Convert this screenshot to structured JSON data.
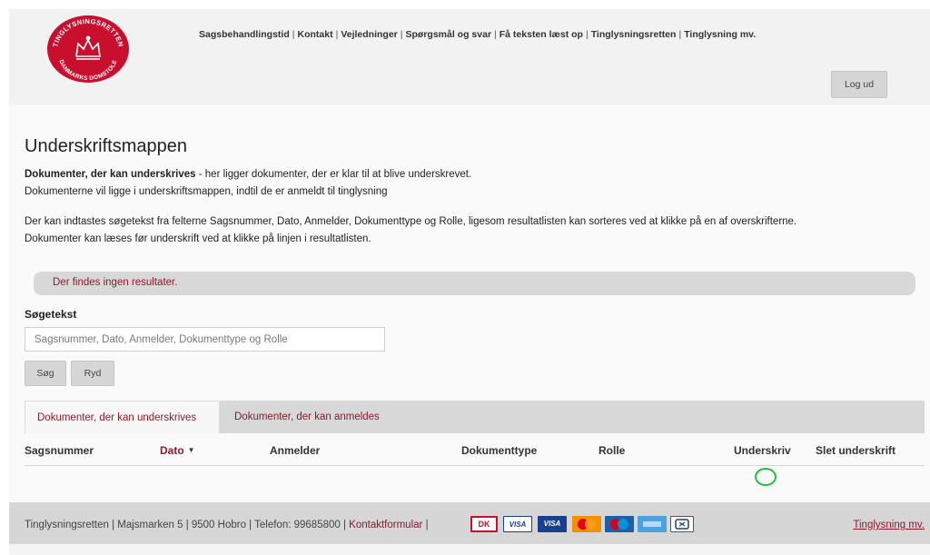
{
  "header": {
    "logo": {
      "top_text": "TINGLYSNINGSRETTEN",
      "bottom_text": "DANMARKS DOMSTOLE",
      "icon": "crown-icon",
      "color": "#c8102e"
    },
    "links": [
      "Sagsbehandlingstid",
      "Kontakt",
      "Vejledninger",
      "Spørgsmål og svar",
      "Få teksten læst op",
      "Tinglysningsretten",
      "Tinglysning mv."
    ],
    "separator": "|",
    "logout_label": "Log ud"
  },
  "page": {
    "title": "Underskriftsmappen",
    "intro_bold": "Dokumenter, der kan underskrives",
    "intro_rest": " - her ligger dokumenter, der er klar til at blive underskrevet.",
    "intro_line2": "Dokumenterne vil ligge i underskriftsmappen, indtil de er anmeldt til tinglysning",
    "help_line1": "Der kan indtastes søgetekst fra felterne Sagsnummer, Dato, Anmelder, Dokumenttype og Rolle, ligesom resultatlisten kan sorteres ved at klikke på en af overskrifterne.",
    "help_line2": "Dokumenter kan læses før underskrift ved at klikke på linjen i resultatlisten.",
    "alert": "Der findes ingen resultater."
  },
  "search": {
    "label": "Søgetekst",
    "value": "",
    "placeholder": "Sagsnummer, Dato, Anmelder, Dokumenttype og Rolle",
    "search_button": "Søg",
    "clear_button": "Ryd"
  },
  "tabs": [
    {
      "label": "Dokumenter, der kan underskrives",
      "active": true
    },
    {
      "label": "Dokumenter, der kan anmeldes",
      "active": false
    }
  ],
  "table": {
    "columns": [
      "Sagsnummer",
      "Dato",
      "Anmelder",
      "Dokumenttype",
      "Rolle",
      "Underskriv",
      "Slet underskrift"
    ],
    "sort_column": "Dato",
    "sort_direction": "descending",
    "rows": []
  },
  "footer": {
    "address": "Tinglysningsretten | Majsmarken 5 | 9500 Hobro | Telefon: 99685800 | ",
    "contact_link": "Kontaktformular",
    "separator": "|",
    "cards": [
      {
        "name": "dankort-icon",
        "text": "DK"
      },
      {
        "name": "visa-icon",
        "text": "VISA"
      },
      {
        "name": "visa-electron-icon",
        "text": "VISA"
      },
      {
        "name": "mastercard-icon",
        "text": ""
      },
      {
        "name": "maestro-icon",
        "text": ""
      },
      {
        "name": "american-express-icon",
        "text": ""
      },
      {
        "name": "jcb-icon",
        "text": ""
      }
    ],
    "right_link": "Tinglysning mv."
  },
  "colors": {
    "accent": "#8b1a2b",
    "header_bg": "#f2f2f2",
    "footer_bg": "#d6d6d6",
    "focus_ring": "#2bbf3f"
  }
}
